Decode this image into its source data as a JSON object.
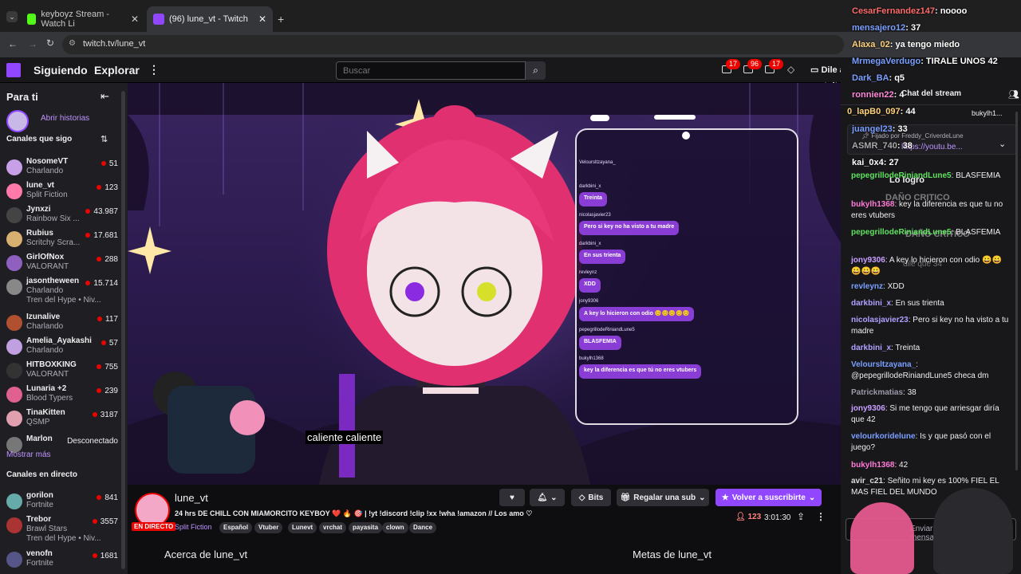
{
  "browser": {
    "tabs": [
      {
        "label": "keyboyz Stream - Watch Li"
      },
      {
        "label": "(96) lune_vt - Twitch"
      }
    ],
    "url": "twitch.tv/lune_vt"
  },
  "topnav": {
    "following": "Siguiendo",
    "explore": "Explorar",
    "search_placeholder": "Buscar",
    "badges": [
      "17",
      "96",
      "17"
    ],
    "ad_free": "Dile adiós a publicidad de forma gratuita"
  },
  "sidebar": {
    "for_you": "Para ti",
    "open_stories": "Abrir historias",
    "followed_title": "Canales que sigo",
    "channels": [
      {
        "name": "NosomeVT",
        "game": "Charlando",
        "viewers": "51",
        "color": "#c8a0e8"
      },
      {
        "name": "lune_vt",
        "game": "Split Fiction",
        "viewers": "123",
        "color": "#ff7aa8"
      },
      {
        "name": "Jynxzi",
        "game": "Rainbow Six ...",
        "viewers": "43.987",
        "color": "#444"
      },
      {
        "name": "Rubius",
        "game": "Scritchy Scra...",
        "viewers": "17.681",
        "color": "#d8b070"
      },
      {
        "name": "GirlOfNox",
        "game": "VALORANT",
        "viewers": "288",
        "color": "#9060c0"
      },
      {
        "name": "jasontheween",
        "game": "Charlando",
        "viewers": "15.714",
        "hype": "Tren del Hype • Niv...",
        "color": "#888"
      },
      {
        "name": "Izunalive",
        "game": "Charlando",
        "viewers": "117",
        "color": "#b05030"
      },
      {
        "name": "Amelia_Ayakashi",
        "game": "Charlando",
        "viewers": "57",
        "color": "#c0a0e0"
      },
      {
        "name": "HITBOXKING",
        "game": "VALORANT",
        "viewers": "755",
        "color": "#333"
      },
      {
        "name": "Lunaria +2",
        "game": "Blood Typers",
        "viewers": "239",
        "color": "#e06090"
      },
      {
        "name": "TinaKitten",
        "game": "QSMP",
        "viewers": "3187",
        "color": "#e0a0b0"
      },
      {
        "name": "Marlon",
        "status": "Desconectado",
        "color": "#777"
      }
    ],
    "show_more": "Mostrar más",
    "live_title": "Canales en directo",
    "live": [
      {
        "name": "gorilon",
        "game": "Fortnite",
        "viewers": "841",
        "color": "#6aa"
      },
      {
        "name": "Trebor",
        "game": "Brawl Stars",
        "viewers": "3557",
        "hype": "Tren del Hype • Niv...",
        "color": "#a33"
      },
      {
        "name": "venofn",
        "game": "Fortnite",
        "viewers": "1681",
        "color": "#558"
      }
    ]
  },
  "video": {
    "caption": "caliente caliente",
    "overlay_chat": [
      {
        "user": "Veloursltzayana_",
        "msg": ""
      },
      {
        "user": "darkbini_x",
        "msg": "Treinta"
      },
      {
        "user": "nicolasjavier23",
        "msg": "Pero si key no ha visto a tu madre"
      },
      {
        "user": "darkbini_x",
        "msg": "En sus trienta"
      },
      {
        "user": "revleynz",
        "msg": "XDD"
      },
      {
        "user": "jony9306",
        "msg": "A key lo hicieron con odio 😊😊😊😊😊"
      },
      {
        "user": "pepegrillodeRiniandLune5",
        "msg": "BLASFEMIA"
      },
      {
        "user": "bukylh1368",
        "msg": "key la diferencia es que tú no eres vtubers"
      }
    ]
  },
  "stream": {
    "channel": "lune_vt",
    "live_badge": "EN DIRECTO",
    "title": "24 hrs DE CHILL CON MIAMORCITO KEYBOY ❤️ 🔥 🎯 | !yt !discord !clip !xx !wha !amazon // Los amo ♡",
    "game": "Split Fiction",
    "tags": [
      "Español",
      "Vtuber",
      "Lunevt",
      "vrchat",
      "payasita",
      "clown",
      "Dance"
    ],
    "bits": "Bits",
    "gift": "Regalar una sub",
    "resub": "Volver a suscribirte",
    "viewers": "123",
    "uptime": "3:01:30",
    "about": "Acerca de lune_vt",
    "goals": "Metas de lune_vt"
  },
  "chat_overlay_top": [
    {
      "user": "CesarFernandez147",
      "msg": "noooo",
      "color": "#ff6a6a"
    },
    {
      "user": "mensajero12",
      "msg": "37",
      "color": "#7a9fff"
    },
    {
      "user": "Alaxa_02",
      "msg": "ya tengo miedo",
      "color": "#ffd27a"
    },
    {
      "user": "MrmegaVerdugo",
      "msg": "TIRALE UNOS 42",
      "color": "#7a9fff"
    },
    {
      "user": "Dark_BA",
      "msg": "q5",
      "color": "#7a9fff"
    },
    {
      "user": "ronnien22",
      "msg": "4",
      "color": "#ff8ad8"
    },
    {
      "user": "0_lapB0_097",
      "msg": "44",
      "color": "#ffd27a"
    },
    {
      "user": "juangel23",
      "msg": "33",
      "color": "#7a9fff"
    },
    {
      "user": "ASMR_740",
      "msg": "38",
      "color": "#aaa"
    },
    {
      "user": "kai_0x4",
      "msg": "27",
      "color": "#fff"
    }
  ],
  "chat": {
    "header": "Chat del stream",
    "pinned_by": "Fijado por",
    "pinned_user": "Freddy_CriverdeLune",
    "pinned_link": "https://youtu.be...",
    "pinned_sub": "bukylh1...",
    "messages": [
      {
        "user": "pepegrillodeRiniandLune5",
        "msg": "BLASFEMIA",
        "color": "#5fe35f"
      },
      {
        "user": "bukylh1368",
        "msg": "key la diferencia es que tu no eres vtubers",
        "color": "#ff7ad8"
      },
      {
        "user": "pepegrillodeRiniandLune5",
        "msg": "BLASFEMIA",
        "color": "#5fe35f"
      },
      {
        "user": "jony9306",
        "msg": "A key lo hicieron con odio 😀😀😀😀😀",
        "color": "#c9a0ff"
      },
      {
        "user": "revleynz",
        "msg": "XDD",
        "color": "#7a9fff"
      },
      {
        "user": "darkbini_x",
        "msg": "En sus trienta",
        "color": "#b0a0ff"
      },
      {
        "user": "nicolasjavier23",
        "msg": "Pero si key no ha visto a tu madre",
        "color": "#b0a0ff"
      },
      {
        "user": "darkbini_x",
        "msg": "Treinta",
        "color": "#b0a0ff"
      },
      {
        "user": "Veloursltzayana_",
        "msg": "@pepegrillodeRiniandLune5 checa dm",
        "color": "#7a9fff"
      },
      {
        "user": "Patrickmatias",
        "msg": "38",
        "color": "#9a9aa8"
      },
      {
        "user": "jony9306",
        "msg": "Si me tengo que arriesgar diría que 42",
        "color": "#c9a0ff"
      },
      {
        "user": "velourkoridelune",
        "msg": "Is y que pasó con el juego?",
        "color": "#7a9fff"
      },
      {
        "user": "bukylh1368",
        "msg": "42",
        "color": "#ff7ad8"
      },
      {
        "user": "avir_c21",
        "msg": "Señito mi key es 100% FIEL EL MAS FIEL DEL MUNDO",
        "color": "#dcdcdc"
      }
    ],
    "danio": "DAÑO CRITICO",
    "logro": "Lo logro",
    "dile": "dile que 34",
    "input_placeholder": "Enviar un mensaje"
  },
  "colors": {
    "twitch_purple": "#9147ff",
    "live_red": "#eb0400",
    "bubble": "#8a3dd4"
  }
}
